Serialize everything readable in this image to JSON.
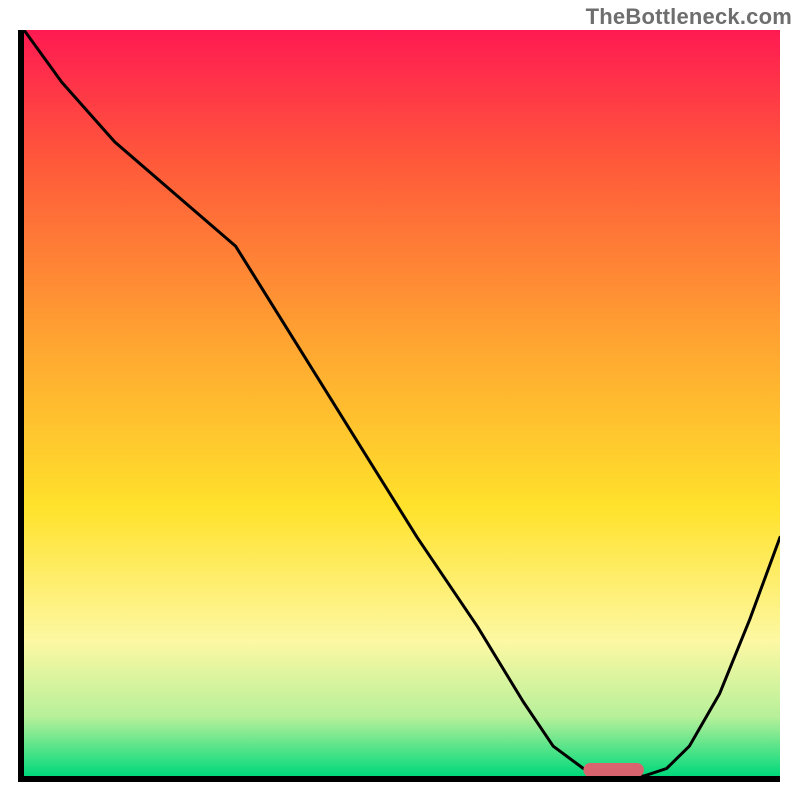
{
  "watermark": "TheBottleneck.com",
  "colors": {
    "gradient_top": "#ff1a52",
    "gradient_mid_red": "#ff5a3a",
    "gradient_orange": "#ffa531",
    "gradient_yellow": "#ffe22b",
    "gradient_pale": "#fdf8a3",
    "gradient_green_light": "#b8f09a",
    "gradient_green": "#00d97b",
    "curve": "#000000",
    "marker": "#d9636e",
    "axis": "#000000"
  },
  "chart_data": {
    "type": "line",
    "title": "",
    "xlabel": "",
    "ylabel": "",
    "xlim": [
      0,
      100
    ],
    "ylim": [
      0,
      100
    ],
    "grid": false,
    "legend": false,
    "series": [
      {
        "name": "bottleneck-curve",
        "x": [
          0,
          5,
          12,
          20,
          28,
          36,
          44,
          52,
          60,
          66,
          70,
          74,
          78,
          82,
          85,
          88,
          92,
          96,
          100
        ],
        "y": [
          100,
          93,
          85,
          78,
          71,
          58,
          45,
          32,
          20,
          10,
          4,
          1,
          0,
          0,
          1,
          4,
          11,
          21,
          32
        ]
      }
    ],
    "marker": {
      "name": "optimal-region",
      "x_range": [
        74,
        82
      ],
      "y": 0.8
    },
    "background_gradient": {
      "axis": "y",
      "stops": [
        {
          "pos": 0.0,
          "color": "#ff1a52"
        },
        {
          "pos": 0.18,
          "color": "#ff5a3a"
        },
        {
          "pos": 0.42,
          "color": "#ffa531"
        },
        {
          "pos": 0.64,
          "color": "#ffe22b"
        },
        {
          "pos": 0.82,
          "color": "#fdf8a3"
        },
        {
          "pos": 0.92,
          "color": "#b8f09a"
        },
        {
          "pos": 1.0,
          "color": "#00d97b"
        }
      ]
    }
  }
}
